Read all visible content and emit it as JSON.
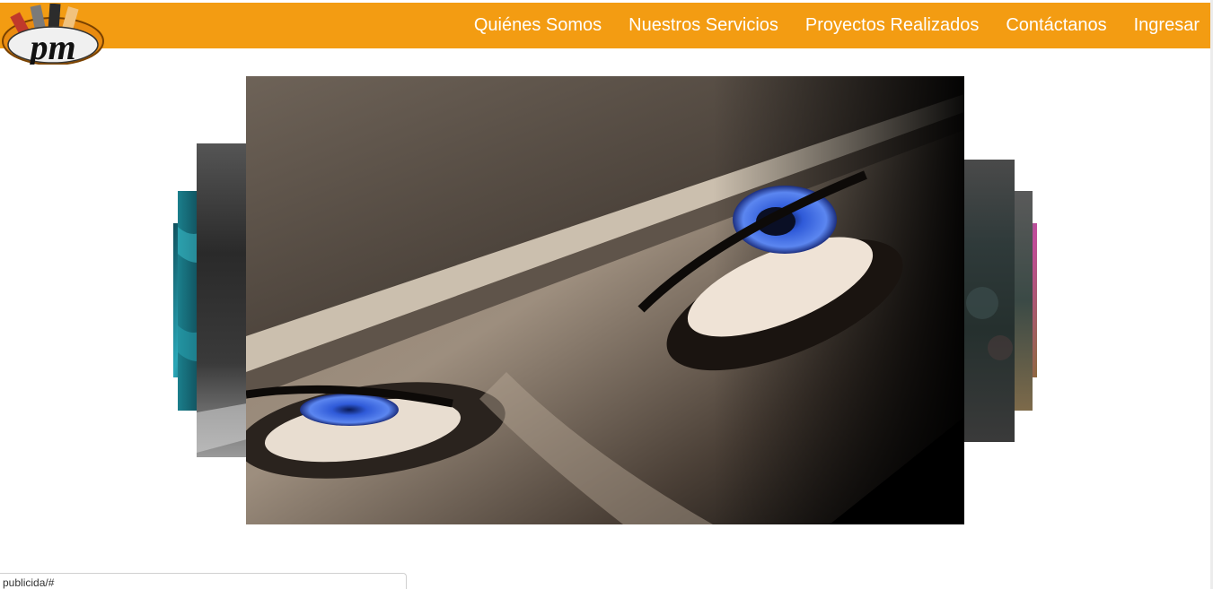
{
  "brand": {
    "logo_text": "pm",
    "accent_color": "#f39c12"
  },
  "nav": {
    "items": [
      {
        "label": "Quiénes Somos"
      },
      {
        "label": "Nuestros Servicios"
      },
      {
        "label": "Proyectos Realizados"
      },
      {
        "label": "Contáctanos"
      },
      {
        "label": "Ingresar"
      }
    ]
  },
  "carousel": {
    "active_slide": "blue-eyes-photo",
    "slides": [
      "abstract-teal",
      "abstract-dark",
      "blue-eyes-photo",
      "grunge-texture",
      "colorful-abstract"
    ]
  },
  "status": {
    "url": "publicida/#"
  }
}
